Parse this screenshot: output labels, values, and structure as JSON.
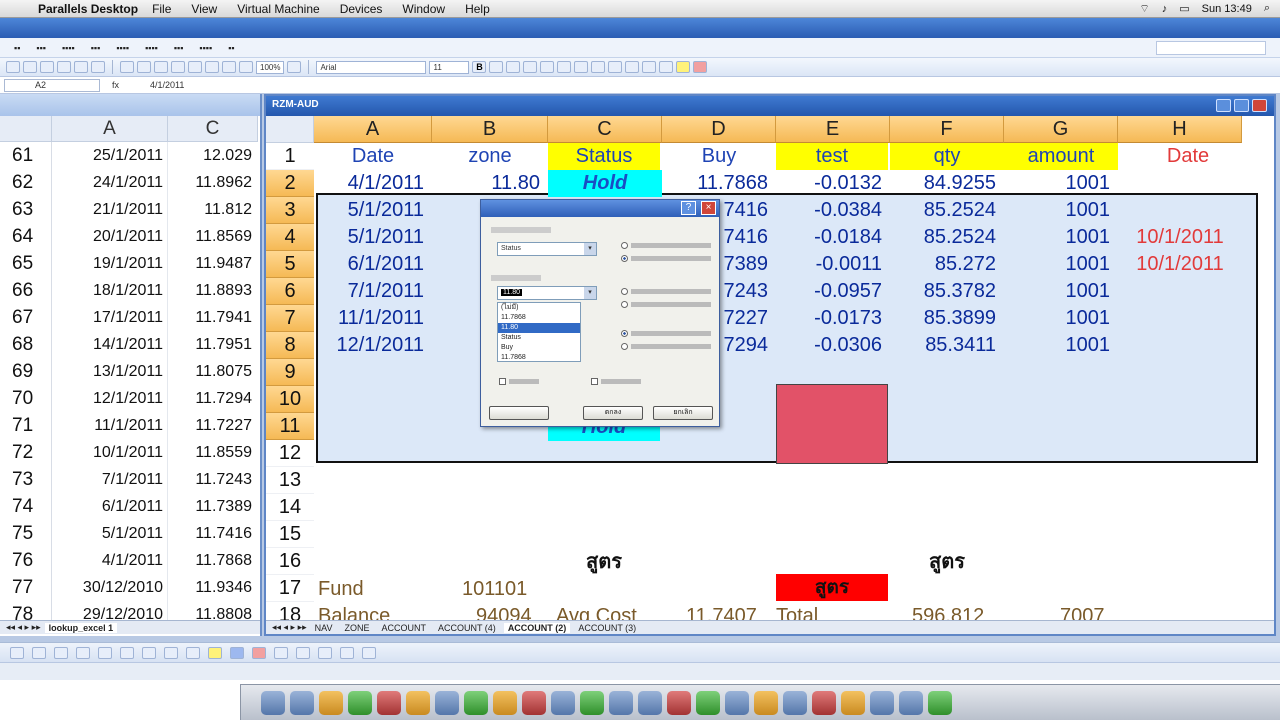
{
  "mac_menu": {
    "app_name": "Parallels Desktop",
    "items": [
      "File",
      "View",
      "Virtual Machine",
      "Devices",
      "Window",
      "Help"
    ],
    "clock": "Sun 13:49"
  },
  "excel": {
    "formula_bar": {
      "name_box": "A2",
      "fx": "fx",
      "value": "4/1/2011"
    },
    "font_name": "Arial",
    "font_size": "11",
    "zoom": "100%"
  },
  "left_window": {
    "col_headers": [
      "A",
      "C"
    ],
    "rows": [
      {
        "n": "61",
        "a": "25/1/2011",
        "c": "12.029"
      },
      {
        "n": "62",
        "a": "24/1/2011",
        "c": "11.8962"
      },
      {
        "n": "63",
        "a": "21/1/2011",
        "c": "11.812"
      },
      {
        "n": "64",
        "a": "20/1/2011",
        "c": "11.8569"
      },
      {
        "n": "65",
        "a": "19/1/2011",
        "c": "11.9487"
      },
      {
        "n": "66",
        "a": "18/1/2011",
        "c": "11.8893"
      },
      {
        "n": "67",
        "a": "17/1/2011",
        "c": "11.7941"
      },
      {
        "n": "68",
        "a": "14/1/2011",
        "c": "11.7951"
      },
      {
        "n": "69",
        "a": "13/1/2011",
        "c": "11.8075"
      },
      {
        "n": "70",
        "a": "12/1/2011",
        "c": "11.7294"
      },
      {
        "n": "71",
        "a": "11/1/2011",
        "c": "11.7227"
      },
      {
        "n": "72",
        "a": "10/1/2011",
        "c": "11.8559"
      },
      {
        "n": "73",
        "a": "7/1/2011",
        "c": "11.7243"
      },
      {
        "n": "74",
        "a": "6/1/2011",
        "c": "11.7389"
      },
      {
        "n": "75",
        "a": "5/1/2011",
        "c": "11.7416"
      },
      {
        "n": "76",
        "a": "4/1/2011",
        "c": "11.7868"
      },
      {
        "n": "77",
        "a": "30/12/2010",
        "c": "11.9346"
      },
      {
        "n": "78",
        "a": "29/12/2010",
        "c": "11.8808"
      }
    ],
    "sheet_tab": "lookup_excel 1"
  },
  "right_window": {
    "title": "RZM-AUD",
    "col_headers": [
      "A",
      "B",
      "C",
      "D",
      "E",
      "F",
      "G",
      "H"
    ],
    "header_row": {
      "a": "Date",
      "b": "zone",
      "c": "Status",
      "d": "Buy",
      "e": "test",
      "f": "qty",
      "g": "amount",
      "h": "Date"
    },
    "rows": [
      {
        "n": "2",
        "a": "4/1/2011",
        "b": "11.80",
        "c": "Hold",
        "d": "11.7868",
        "e": "-0.0132",
        "f": "84.9255",
        "g": "1001",
        "h": ""
      },
      {
        "n": "3",
        "a": "5/1/2011",
        "b": "",
        "c": "",
        "d": "7416",
        "e": "-0.0384",
        "f": "85.2524",
        "g": "1001",
        "h": ""
      },
      {
        "n": "4",
        "a": "5/1/2011",
        "b": "",
        "c": "",
        "d": "7416",
        "e": "-0.0184",
        "f": "85.2524",
        "g": "1001",
        "h": "10/1/2011"
      },
      {
        "n": "5",
        "a": "6/1/2011",
        "b": "",
        "c": "",
        "d": "7389",
        "e": "-0.0011",
        "f": "85.272",
        "g": "1001",
        "h": "10/1/2011"
      },
      {
        "n": "6",
        "a": "7/1/2011",
        "b": "",
        "c": "",
        "d": "7243",
        "e": "-0.0957",
        "f": "85.3782",
        "g": "1001",
        "h": ""
      },
      {
        "n": "7",
        "a": "11/1/2011",
        "b": "",
        "c": "",
        "d": "7227",
        "e": "-0.0173",
        "f": "85.3899",
        "g": "1001",
        "h": ""
      },
      {
        "n": "8",
        "a": "12/1/2011",
        "b": "",
        "c": "",
        "d": "7294",
        "e": "-0.0306",
        "f": "85.3411",
        "g": "1001",
        "h": ""
      }
    ],
    "row_numbers_tail": [
      "9",
      "10",
      "11",
      "12",
      "13",
      "14",
      "15",
      "16",
      "17",
      "18"
    ],
    "hold_bottom": "Hold",
    "formula_labels": [
      "สูตร",
      "สูตร",
      "สูตร"
    ],
    "fund_label": "Fund",
    "fund_value": "101101",
    "balance_label": "Balance",
    "balance_value": "94094",
    "avg_cost_label": "Avg Cost",
    "avg_cost_value": "11.7407",
    "total_label": "Total",
    "total_value": "596.812",
    "total_amount": "7007",
    "sheet_tabs": [
      "NAV",
      "ZONE",
      "ACCOUNT",
      "ACCOUNT (4)",
      "ACCOUNT (2)",
      "ACCOUNT (3)"
    ],
    "active_tab": "ACCOUNT (2)"
  },
  "dialog": {
    "list_items": [
      "(ไม่มี)",
      "11.7868",
      "11.80",
      "Status",
      "Buy",
      "11.7868"
    ],
    "highlight_index": 2,
    "combo1": "Status",
    "combo2": "11.80",
    "ok": "ตกลง",
    "cancel": "ยกเลิก"
  }
}
